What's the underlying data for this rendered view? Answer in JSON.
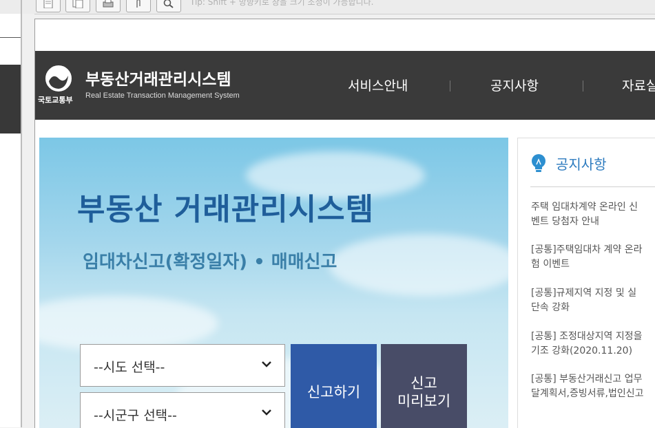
{
  "toolbar": {
    "buttons": [
      "page-icon",
      "copy-icon",
      "print-icon",
      "attach-icon",
      "search-icon"
    ],
    "hint": "Tip: Shift + 방향키로 창을 크기 조정이 가능합니다."
  },
  "header": {
    "ministry": "국토교통부",
    "title": "부동산거래관리시스템",
    "subtitle": "Real Estate Transaction Management System",
    "nav": [
      "서비스안내",
      "공지사항",
      "자료실"
    ]
  },
  "hero": {
    "title": "부동산 거래관리시스템",
    "subtitle": "임대차신고(확정일자) • 매매신고",
    "sido_select": "--시도 선택--",
    "sigungu_select": "--시군구 선택--",
    "report_button": "신고하기",
    "preview_button": "신고\n미리보기"
  },
  "notice": {
    "title": "공지사항",
    "items": [
      {
        "line1": "주택 임대차계약 온라인 신",
        "line2": "벤트 당첨자 안내"
      },
      {
        "line1": "[공통]주택임대차 계약 온라",
        "line2": "험 이벤트"
      },
      {
        "line1": "[공통]규제지역 지정 및 실",
        "line2": "단속 강화"
      },
      {
        "line1": "[공통] 조정대상지역 지정을",
        "line2": "기조 강화(2020.11.20)"
      },
      {
        "line1": "[공통] 부동산거래신고 업무",
        "line2": "달계획서,증빙서류,법인신고"
      }
    ]
  },
  "colors": {
    "header_bg": "#3a3a3a",
    "hero_title": "#1f5e9a",
    "report_button": "#2f5aa7",
    "preview_button": "#484c67",
    "notice_title": "#2d7bbf"
  }
}
